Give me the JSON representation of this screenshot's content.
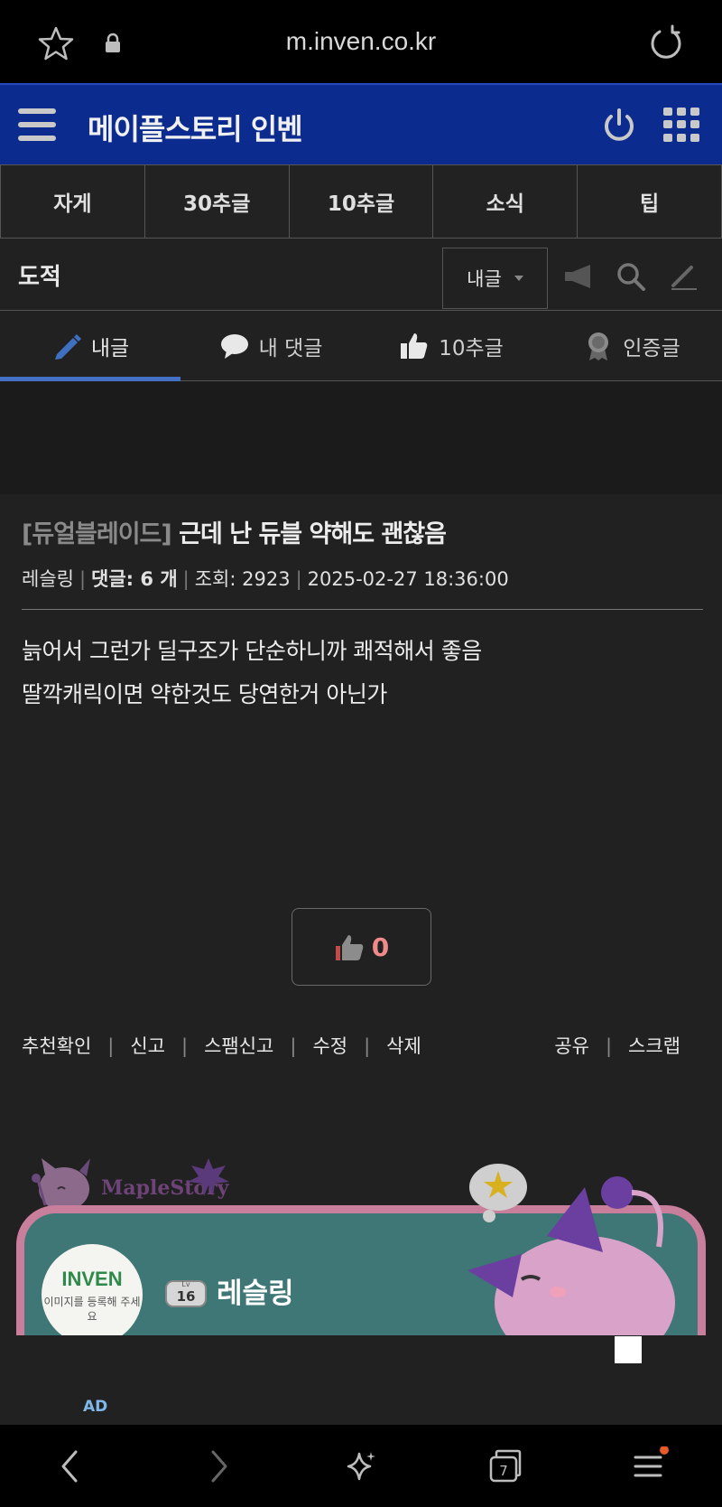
{
  "browser": {
    "url": "m.inven.co.kr",
    "tab_count": "7"
  },
  "site": {
    "title": "메이플스토리 인벤"
  },
  "categories": [
    "자게",
    "30추글",
    "10추글",
    "소식",
    "팁"
  ],
  "board": {
    "name": "도적",
    "filter_selected": "내글"
  },
  "my_tabs": [
    "내글",
    "내 댓글",
    "10추글",
    "인증글"
  ],
  "article": {
    "prefix": "[듀얼블레이드]",
    "subject": "근데 난 듀블 약해도 괜찮음",
    "author": "레슬링",
    "comments": "댓글: 6 개",
    "views": "조회: 2923",
    "datetime": "2025-02-27 18:36:00",
    "body_lines": [
      "늙어서 그런가 딜구조가 단순하니까 쾌적해서 좋음",
      "딸깍캐릭이면 약한것도 당연한거 아닌가"
    ],
    "likes": "0"
  },
  "actions": {
    "left": [
      "추천확인",
      "신고",
      "스팸신고",
      "수정",
      "삭제"
    ],
    "right": [
      "공유",
      "스크랩"
    ]
  },
  "profile": {
    "watermark": "MapleStory",
    "logo_text": "INVEN",
    "logo_sub": "이미지를 등록해 주세요",
    "level": "16",
    "level_label": "Lv",
    "nickname": "레슬링",
    "card_color": "#3f7676",
    "frame_color": "#c97f9c"
  },
  "ad_label": "AD",
  "colors": {
    "header_bg": "#0b2b8f",
    "active_tab": "#4471c4",
    "like_count": "#f08a8a"
  }
}
